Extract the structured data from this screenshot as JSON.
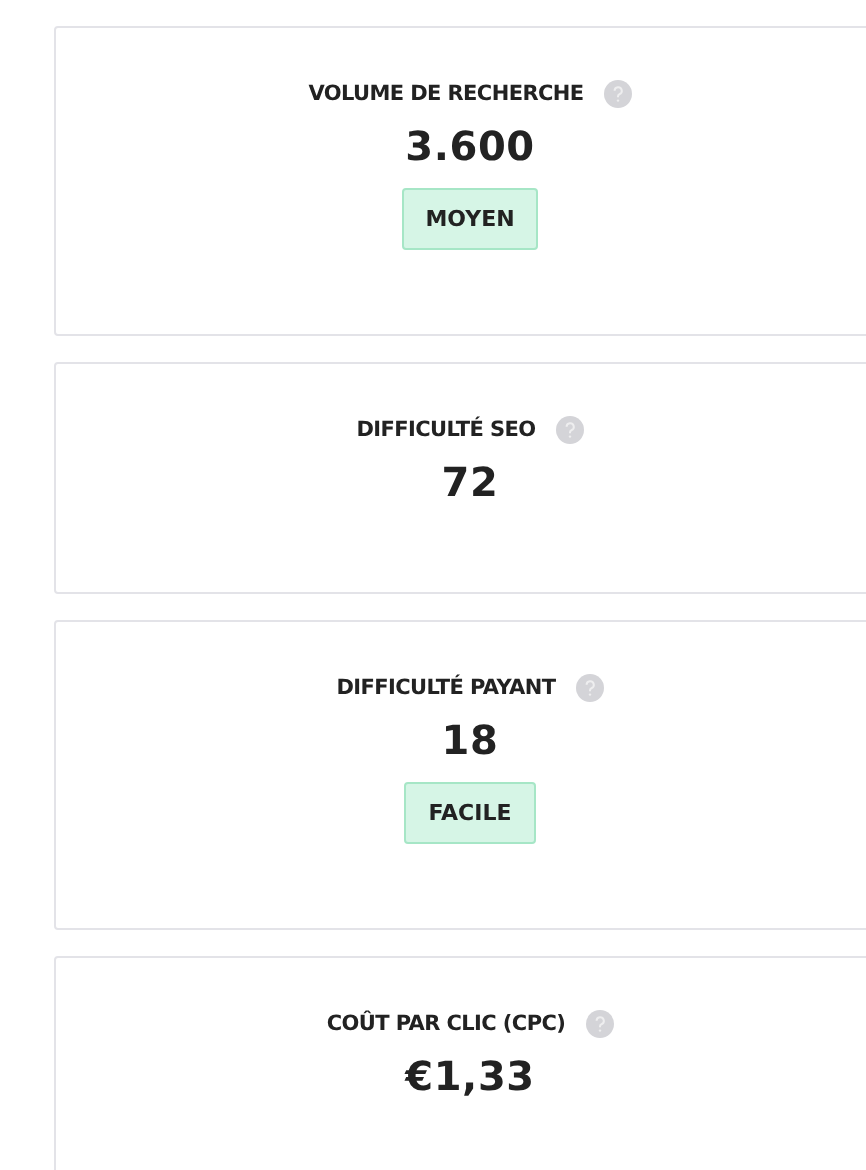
{
  "metrics": [
    {
      "title": "VOLUME DE RECHERCHE",
      "value": "3.600",
      "badge": "MOYEN"
    },
    {
      "title": "DIFFICULTÉ SEO",
      "value": "72"
    },
    {
      "title": "DIFFICULTÉ PAYANT",
      "value": "18",
      "badge": "FACILE"
    },
    {
      "title": "COÛT PAR CLIC (CPC)",
      "value": "€1,33"
    }
  ]
}
